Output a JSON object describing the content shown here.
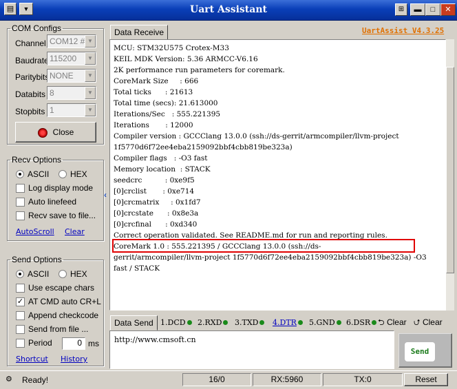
{
  "window": {
    "title": "Uart Assistant",
    "menu_icon": "menu-icon",
    "minimize_glyph": "▬",
    "maximize_glyph": "□",
    "close_glyph": "✕"
  },
  "com_configs": {
    "title": "COM Configs",
    "fields": [
      {
        "label": "Channel",
        "value": "COM12 #"
      },
      {
        "label": "Baudrate",
        "value": "115200"
      },
      {
        "label": "Paritybits",
        "value": "NONE"
      },
      {
        "label": "Databits",
        "value": "8"
      },
      {
        "label": "Stopbits",
        "value": "1"
      }
    ],
    "close_button": "Close"
  },
  "recv_options": {
    "title": "Recv Options",
    "ascii_label": "ASCII",
    "hex_label": "HEX",
    "log_display_mode": "Log display mode",
    "auto_linefeed": "Auto linefeed",
    "recv_save_to_file": "Recv save to file...",
    "autoscroll_link": "AutoScroll",
    "clear_link": "Clear"
  },
  "send_options": {
    "title": "Send Options",
    "ascii_label": "ASCII",
    "hex_label": "HEX",
    "use_escape_chars": "Use escape chars",
    "at_cmd": "AT CMD auto CR+L",
    "append_checkcode": "Append checkcode",
    "send_from_file": "Send from file ...",
    "period_label": "Period",
    "period_value": "0",
    "period_unit": "ms",
    "shortcut_link": "Shortcut",
    "history_link": "History"
  },
  "receive": {
    "tab_label": "Data Receive",
    "version": "UartAssist V4.3.25",
    "lines": [
      "MCU: STM32U575 Crotex-M33",
      "KEIL MDK Version: 5.36 ARMCC-V6.16",
      "2K performance run parameters for coremark.",
      "CoreMark Size     : 666",
      "Total ticks      : 21613",
      "Total time (secs): 21.613000",
      "Iterations/Sec   : 555.221395",
      "Iterations       : 12000",
      "Compiler version : GCCClang 13.0.0 (ssh://ds-gerrit/armcompiler/llvm-project",
      "1f5770d6f72ee4eba2159092bbf4cbb819be323a)",
      "Compiler flags   : -O3 fast",
      "Memory location  : STACK",
      "seedcrc          : 0xe9f5",
      "[0]crclist       : 0xe714",
      "[0]crcmatrix     : 0x1fd7",
      "[0]crcstate      : 0x8e3a",
      "[0]crcfinal      : 0xd340",
      "Correct operation validated. See README.md for run and reporting rules.",
      "CoreMark 1.0 : 555.221395 / GCCClang 13.0.0 (ssh://ds-",
      "gerrit/armcompiler/llvm-project 1f5770d6f72ee4eba2159092bbf4cbb819be323a) -O3",
      "fast / STACK"
    ]
  },
  "send": {
    "tab_label": "Data Send",
    "signals": [
      "1.DCD",
      "2.RXD",
      "3.TXD",
      "4.DTR",
      "5.GND",
      "6.DSR"
    ],
    "clear1": "Clear",
    "clear2": "Clear",
    "input_value": "http://www.cmsoft.cn",
    "send_button": "Send"
  },
  "status": {
    "ready": "Ready!",
    "counter": "16/0",
    "rx": "RX:5960",
    "tx": "TX:0",
    "reset": "Reset"
  },
  "colors": {
    "title_bar": "#0a3fb8",
    "highlight_box": "#e00000",
    "version_text": "#e07000",
    "link": "#0000c0"
  }
}
